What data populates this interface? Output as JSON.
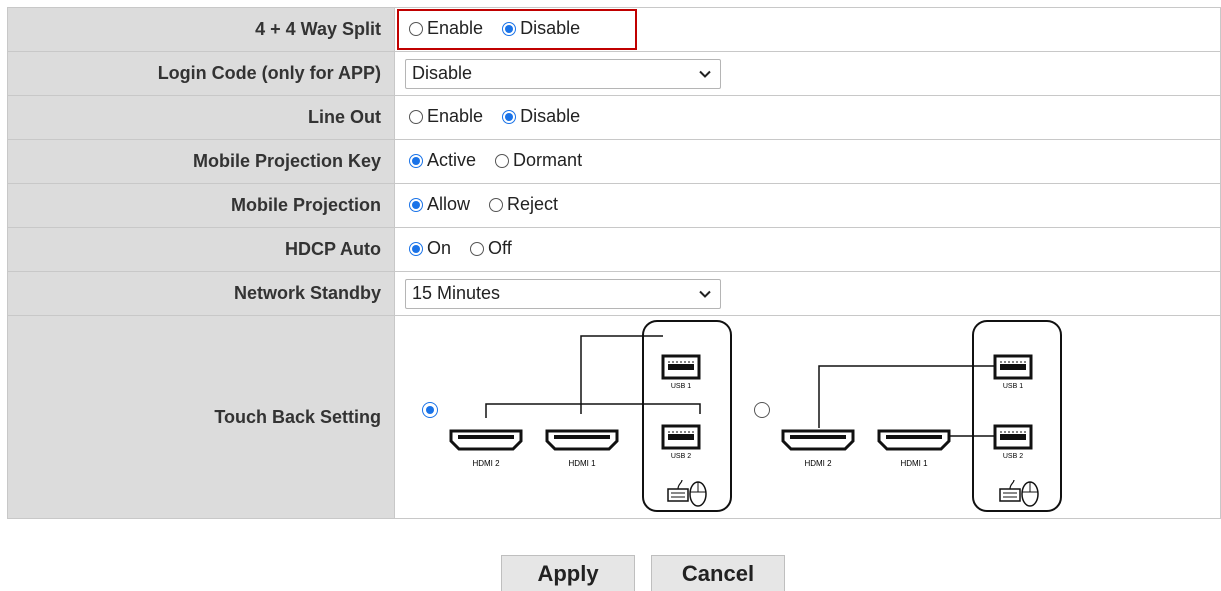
{
  "rows": [
    {
      "label": "4 + 4 Way Split",
      "options": [
        "Enable",
        "Disable"
      ],
      "selected": "Disable"
    },
    {
      "label": "Login Code (only for APP)",
      "select_value": "Disable"
    },
    {
      "label": "Line Out",
      "options": [
        "Enable",
        "Disable"
      ],
      "selected": "Disable"
    },
    {
      "label": "Mobile Projection Key",
      "options": [
        "Active",
        "Dormant"
      ],
      "selected": "Active"
    },
    {
      "label": "Mobile Projection",
      "options": [
        "Allow",
        "Reject"
      ],
      "selected": "Allow"
    },
    {
      "label": "HDCP Auto",
      "options": [
        "On",
        "Off"
      ],
      "selected": "On"
    },
    {
      "label": "Network Standby",
      "select_value": "15 Minutes"
    },
    {
      "label": "Touch Back Setting",
      "selected_option": 1
    }
  ],
  "diagram": {
    "hdmi2": "HDMI 2",
    "hdmi1": "HDMI 1",
    "usb1": "USB 1",
    "usb2": "USB 2"
  },
  "buttons": {
    "apply": "Apply",
    "cancel": "Cancel"
  },
  "colors": {
    "accent": "#1a73e8",
    "highlight": "#c00000",
    "label_bg": "#dcdcdc"
  }
}
